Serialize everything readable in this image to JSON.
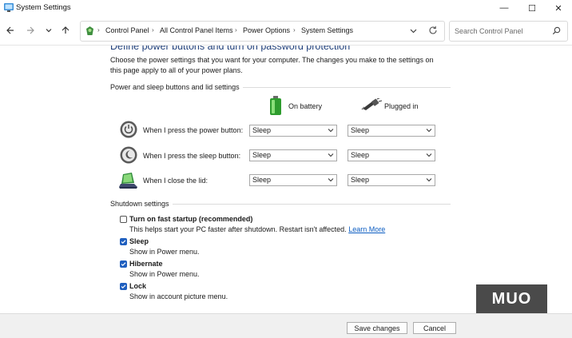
{
  "window": {
    "title": "System Settings",
    "minimize_glyph": "—",
    "maximize_glyph": "☐",
    "close_glyph": "✕"
  },
  "breadcrumb": [
    "Control Panel",
    "All Control Panel Items",
    "Power Options",
    "System Settings"
  ],
  "search": {
    "placeholder": "Search Control Panel"
  },
  "page": {
    "heading": "Define power buttons and turn on password protection",
    "intro": "Choose the power settings that you want for your computer. The changes you make to the settings on this page apply to all of your power plans."
  },
  "power_group": {
    "label": "Power and sleep buttons and lid settings",
    "col_battery": "On battery",
    "col_plugged": "Plugged in",
    "rows": [
      {
        "label": "When I press the power button:",
        "battery": "Sleep",
        "plugged": "Sleep"
      },
      {
        "label": "When I press the sleep button:",
        "battery": "Sleep",
        "plugged": "Sleep"
      },
      {
        "label": "When I close the lid:",
        "battery": "Sleep",
        "plugged": "Sleep"
      }
    ]
  },
  "shutdown_group": {
    "label": "Shutdown settings",
    "options": [
      {
        "title": "Turn on fast startup (recommended)",
        "desc": "This helps start your PC faster after shutdown. Restart isn't affected.",
        "link": "Learn More",
        "checked": false
      },
      {
        "title": "Sleep",
        "desc": "Show in Power menu.",
        "checked": true
      },
      {
        "title": "Hibernate",
        "desc": "Show in Power menu.",
        "checked": true
      },
      {
        "title": "Lock",
        "desc": "Show in account picture menu.",
        "checked": true
      }
    ]
  },
  "footer": {
    "save": "Save changes",
    "cancel": "Cancel"
  },
  "watermark": "MUO",
  "colors": {
    "accent": "#1f5fbf",
    "heading": "#1f3f7a",
    "link": "#0b5cc1"
  }
}
